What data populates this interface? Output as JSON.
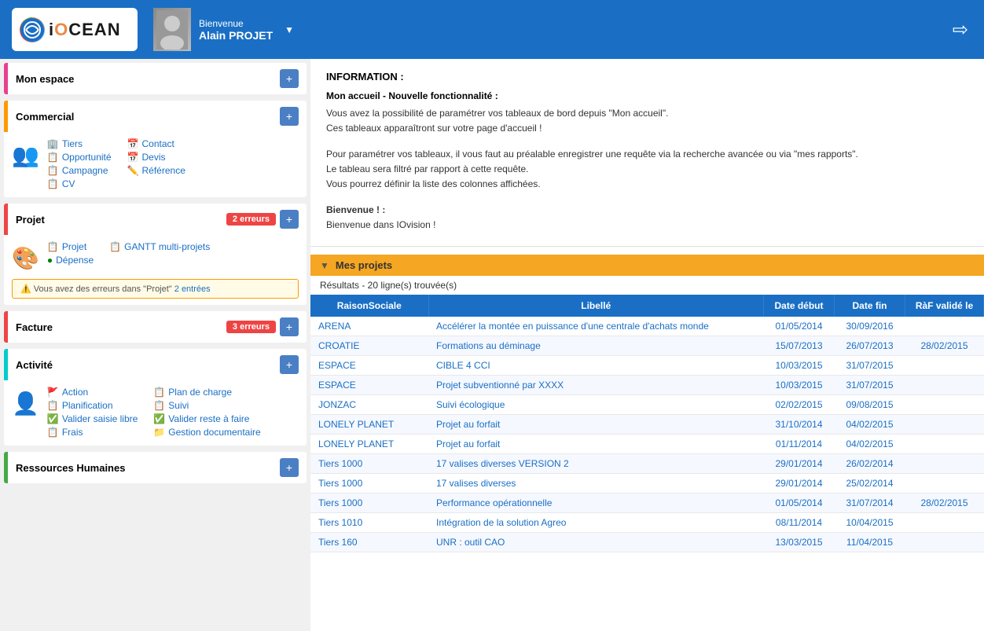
{
  "header": {
    "logo_text": "iOCEAN",
    "greeting": "Bienvenue",
    "username": "Alain PROJET",
    "logout_icon": "⇨"
  },
  "sidebar": {
    "sections": [
      {
        "id": "mon-espace",
        "label": "Mon espace",
        "color": "pink",
        "has_pin": true,
        "error_count": null,
        "items": []
      },
      {
        "id": "commercial",
        "label": "Commercial",
        "color": "orange",
        "has_pin": true,
        "error_count": null,
        "icon": "👥",
        "col1": [
          {
            "label": "Tiers",
            "icon": "🏢"
          },
          {
            "label": "Opportunité",
            "icon": "📋"
          },
          {
            "label": "Campagne",
            "icon": "📋"
          },
          {
            "label": "CV",
            "icon": "📋"
          }
        ],
        "col2": [
          {
            "label": "Contact",
            "icon": "📅"
          },
          {
            "label": "Devis",
            "icon": "📅"
          },
          {
            "label": "Référence",
            "icon": "✏️"
          }
        ]
      },
      {
        "id": "projet",
        "label": "Projet",
        "color": "red",
        "has_pin": true,
        "error_count": "2 erreurs",
        "icon": "🎨",
        "col1": [
          {
            "label": "Projet",
            "icon": "📋"
          },
          {
            "label": "Dépense",
            "icon": "🟢"
          }
        ],
        "col2": [
          {
            "label": "GANTT multi-projets",
            "icon": "📋"
          }
        ],
        "warning": "Vous avez des erreurs dans \"Projet\" 2 entrées"
      },
      {
        "id": "facture",
        "label": "Facture",
        "color": "red",
        "has_pin": true,
        "error_count": "3 erreurs",
        "items": []
      },
      {
        "id": "activite",
        "label": "Activité",
        "color": "cyan",
        "has_pin": true,
        "error_count": null,
        "icon": "👤",
        "col1": [
          {
            "label": "Action",
            "icon": "🚩"
          },
          {
            "label": "Planification",
            "icon": "📋"
          },
          {
            "label": "Valider saisie libre",
            "icon": "✅"
          },
          {
            "label": "Frais",
            "icon": "📋"
          }
        ],
        "col2": [
          {
            "label": "Plan de charge",
            "icon": "📋"
          },
          {
            "label": "Suivi",
            "icon": "📋"
          },
          {
            "label": "Valider reste à faire",
            "icon": "✅"
          },
          {
            "label": "Gestion documentaire",
            "icon": "📁"
          }
        ]
      },
      {
        "id": "ressources-humaines",
        "label": "Ressources Humaines",
        "color": "green",
        "has_pin": true,
        "error_count": null,
        "items": []
      }
    ]
  },
  "info": {
    "title": "INFORMATION :",
    "subtitle": "Mon accueil - Nouvelle fonctionnalité :",
    "paragraphs": [
      "Vous avez la possibilité de paramétrer vos tableaux de bord depuis \"Mon accueil\".",
      "Ces tableaux apparaîtront sur votre page d'accueil !",
      "Pour paramétrer vos tableaux, il vous faut au préalable enregistrer une requête via la recherche avancée ou via \"mes rapports\".",
      "Le tableau sera filtré par rapport à cette requête.",
      "Vous pourrez définir la liste des colonnes affichées.",
      "Bienvenue ! :",
      "Bienvenue dans IOvision !"
    ]
  },
  "projets": {
    "title": "Mes projets",
    "results_label": "Résultats - 20 ligne(s) trouvée(s)",
    "columns": [
      "Raison Sociale",
      "Libellé",
      "Date début",
      "Date fin",
      "RàF validé le"
    ],
    "rows": [
      {
        "raison": "ARENA",
        "libelle": "Accélérer la montée en puissance d'une centrale d'achats monde",
        "date_debut": "01/05/2014",
        "date_fin": "30/09/2016",
        "raf": ""
      },
      {
        "raison": "CROATIE",
        "libelle": "Formations au déminage",
        "date_debut": "15/07/2013",
        "date_fin": "26/07/2013",
        "raf": "28/02/2015"
      },
      {
        "raison": "ESPACE",
        "libelle": "CIBLE 4 CCI",
        "date_debut": "10/03/2015",
        "date_fin": "31/07/2015",
        "raf": ""
      },
      {
        "raison": "ESPACE",
        "libelle": "Projet subventionné par XXXX",
        "date_debut": "10/03/2015",
        "date_fin": "31/07/2015",
        "raf": ""
      },
      {
        "raison": "JONZAC",
        "libelle": "Suivi écologique",
        "date_debut": "02/02/2015",
        "date_fin": "09/08/2015",
        "raf": ""
      },
      {
        "raison": "LONELY PLANET",
        "libelle": "Projet au forfait",
        "date_debut": "31/10/2014",
        "date_fin": "04/02/2015",
        "raf": ""
      },
      {
        "raison": "LONELY PLANET",
        "libelle": "Projet au forfait",
        "date_debut": "01/11/2014",
        "date_fin": "04/02/2015",
        "raf": ""
      },
      {
        "raison": "Tiers 1000",
        "libelle": "17 valises diverses VERSION 2",
        "date_debut": "29/01/2014",
        "date_fin": "26/02/2014",
        "raf": ""
      },
      {
        "raison": "Tiers 1000",
        "libelle": "17 valises diverses",
        "date_debut": "29/01/2014",
        "date_fin": "25/02/2014",
        "raf": ""
      },
      {
        "raison": "Tiers 1000",
        "libelle": "Performance opérationnelle",
        "date_debut": "01/05/2014",
        "date_fin": "31/07/2014",
        "raf": "28/02/2015"
      },
      {
        "raison": "Tiers 1010",
        "libelle": "Intégration de la solution Agreo",
        "date_debut": "08/11/2014",
        "date_fin": "10/04/2015",
        "raf": ""
      },
      {
        "raison": "Tiers 160",
        "libelle": "UNR : outil CAO",
        "date_debut": "13/03/2015",
        "date_fin": "11/04/2015",
        "raf": ""
      }
    ]
  }
}
